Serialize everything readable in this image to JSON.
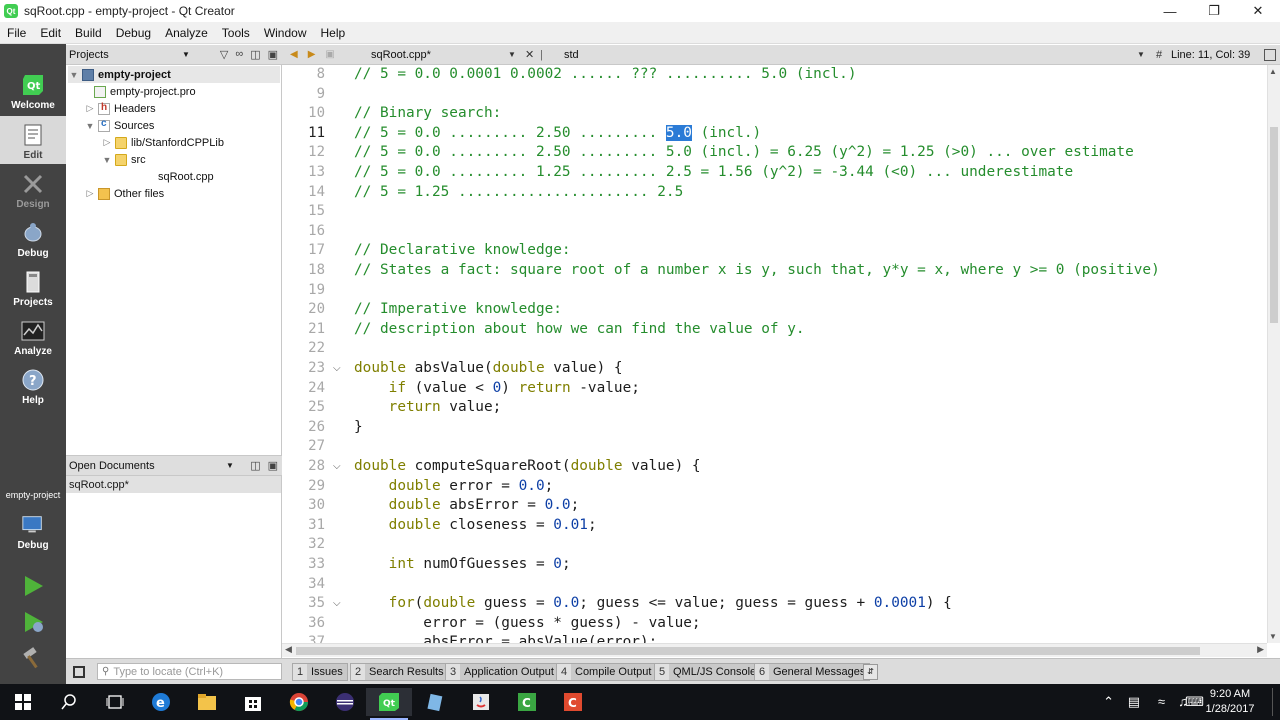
{
  "window": {
    "title": "sqRoot.cpp - empty-project - Qt Creator",
    "minimize": "—",
    "maximize": "❐",
    "close": "✕"
  },
  "menu": [
    "File",
    "Edit",
    "Build",
    "Debug",
    "Analyze",
    "Tools",
    "Window",
    "Help"
  ],
  "modes": {
    "welcome": "Welcome",
    "edit": "Edit",
    "design": "Design",
    "debug": "Debug",
    "projects": "Projects",
    "analyze": "Analyze",
    "help": "Help",
    "target_project": "empty-project",
    "target_mode": "Debug"
  },
  "projects_pane": {
    "header": "Projects",
    "tree": {
      "root": "empty-project",
      "pro_file": "empty-project.pro",
      "headers": "Headers",
      "sources": "Sources",
      "lib": "lib/StanfordCPPLib",
      "src": "src",
      "file": "sqRoot.cpp",
      "other": "Other files"
    }
  },
  "open_documents": {
    "header": "Open Documents",
    "items": [
      "sqRoot.cpp*"
    ]
  },
  "editor_toolbar": {
    "file": "sqRoot.cpp*",
    "symbol": "std",
    "hash": "#",
    "line_info": "Line: 11, Col: 39"
  },
  "editor": {
    "current_line": 11,
    "lines": [
      {
        "n": 8,
        "seg": [
          {
            "t": "// 5 = 0.0 0.0001 0.0002 ...... ??? .......... 5.0 (incl.)",
            "c": "comment"
          }
        ]
      },
      {
        "n": 9,
        "seg": []
      },
      {
        "n": 10,
        "seg": [
          {
            "t": "// Binary search:",
            "c": "comment"
          }
        ]
      },
      {
        "n": 11,
        "seg": [
          {
            "t": "// 5 = 0.0 ......... 2.50 ......... ",
            "c": "comment"
          },
          {
            "t": "5.0",
            "c": "hl"
          },
          {
            "t": " (incl.)",
            "c": "comment"
          }
        ]
      },
      {
        "n": 12,
        "seg": [
          {
            "t": "// 5 = 0.0 ......... 2.50 ......... 5.0 (incl.) = 6.25 (y^2) = 1.25 (>0) ... over estimate",
            "c": "comment"
          }
        ]
      },
      {
        "n": 13,
        "seg": [
          {
            "t": "// 5 = 0.0 ......... 1.25 ......... 2.5 = 1.56 (y^2) = -3.44 (<0) ... underestimate",
            "c": "comment"
          }
        ]
      },
      {
        "n": 14,
        "seg": [
          {
            "t": "// 5 = 1.25 ...................... 2.5",
            "c": "comment"
          }
        ]
      },
      {
        "n": 15,
        "seg": []
      },
      {
        "n": 16,
        "seg": []
      },
      {
        "n": 17,
        "seg": [
          {
            "t": "// Declarative knowledge:",
            "c": "comment"
          }
        ]
      },
      {
        "n": 18,
        "seg": [
          {
            "t": "// States a fact: square root of a number x is y, such that, y*y = x, where y >= 0 (positive)",
            "c": "comment"
          }
        ]
      },
      {
        "n": 19,
        "seg": []
      },
      {
        "n": 20,
        "seg": [
          {
            "t": "// Imperative knowledge:",
            "c": "comment"
          }
        ]
      },
      {
        "n": 21,
        "seg": [
          {
            "t": "// description about how we can find the value of y.",
            "c": "comment"
          }
        ]
      },
      {
        "n": 22,
        "seg": []
      },
      {
        "n": 23,
        "fold": true,
        "seg": [
          {
            "t": "double",
            "c": "kw"
          },
          {
            "t": " absValue(",
            "c": "plain"
          },
          {
            "t": "double",
            "c": "kw"
          },
          {
            "t": " value) {",
            "c": "plain"
          }
        ]
      },
      {
        "n": 24,
        "seg": [
          {
            "t": "    ",
            "c": "plain"
          },
          {
            "t": "if",
            "c": "kw"
          },
          {
            "t": " (value < ",
            "c": "plain"
          },
          {
            "t": "0",
            "c": "num"
          },
          {
            "t": ") ",
            "c": "plain"
          },
          {
            "t": "return",
            "c": "kw"
          },
          {
            "t": " -value;",
            "c": "plain"
          }
        ]
      },
      {
        "n": 25,
        "seg": [
          {
            "t": "    ",
            "c": "plain"
          },
          {
            "t": "return",
            "c": "kw"
          },
          {
            "t": " value;",
            "c": "plain"
          }
        ]
      },
      {
        "n": 26,
        "seg": [
          {
            "t": "}",
            "c": "plain"
          }
        ]
      },
      {
        "n": 27,
        "seg": []
      },
      {
        "n": 28,
        "fold": true,
        "seg": [
          {
            "t": "double",
            "c": "kw"
          },
          {
            "t": " computeSquareRoot(",
            "c": "plain"
          },
          {
            "t": "double",
            "c": "kw"
          },
          {
            "t": " value) {",
            "c": "plain"
          }
        ]
      },
      {
        "n": 29,
        "seg": [
          {
            "t": "    ",
            "c": "plain"
          },
          {
            "t": "double",
            "c": "kw"
          },
          {
            "t": " error = ",
            "c": "plain"
          },
          {
            "t": "0.0",
            "c": "num"
          },
          {
            "t": ";",
            "c": "plain"
          }
        ]
      },
      {
        "n": 30,
        "seg": [
          {
            "t": "    ",
            "c": "plain"
          },
          {
            "t": "double",
            "c": "kw"
          },
          {
            "t": " absError = ",
            "c": "plain"
          },
          {
            "t": "0.0",
            "c": "num"
          },
          {
            "t": ";",
            "c": "plain"
          }
        ]
      },
      {
        "n": 31,
        "seg": [
          {
            "t": "    ",
            "c": "plain"
          },
          {
            "t": "double",
            "c": "kw"
          },
          {
            "t": " closeness = ",
            "c": "plain"
          },
          {
            "t": "0.01",
            "c": "num"
          },
          {
            "t": ";",
            "c": "plain"
          }
        ]
      },
      {
        "n": 32,
        "seg": []
      },
      {
        "n": 33,
        "seg": [
          {
            "t": "    ",
            "c": "plain"
          },
          {
            "t": "int",
            "c": "kw"
          },
          {
            "t": " numOfGuesses = ",
            "c": "plain"
          },
          {
            "t": "0",
            "c": "num"
          },
          {
            "t": ";",
            "c": "plain"
          }
        ]
      },
      {
        "n": 34,
        "seg": []
      },
      {
        "n": 35,
        "fold": true,
        "seg": [
          {
            "t": "    ",
            "c": "plain"
          },
          {
            "t": "for",
            "c": "kw"
          },
          {
            "t": "(",
            "c": "plain"
          },
          {
            "t": "double",
            "c": "kw"
          },
          {
            "t": " guess = ",
            "c": "plain"
          },
          {
            "t": "0.0",
            "c": "num"
          },
          {
            "t": "; guess <= value; guess = guess + ",
            "c": "plain"
          },
          {
            "t": "0.0001",
            "c": "num"
          },
          {
            "t": ") {",
            "c": "plain"
          }
        ]
      },
      {
        "n": 36,
        "seg": [
          {
            "t": "        error = (guess * guess) - value;",
            "c": "plain"
          }
        ]
      },
      {
        "n": 37,
        "seg": [
          {
            "t": "        absError = absValue(error);",
            "c": "plain"
          }
        ]
      }
    ]
  },
  "locator": {
    "placeholder": "Type to locate (Ctrl+K)"
  },
  "output_tabs": [
    {
      "num": "1",
      "label": "Issues"
    },
    {
      "num": "2",
      "label": "Search Results"
    },
    {
      "num": "3",
      "label": "Application Output"
    },
    {
      "num": "4",
      "label": "Compile Output"
    },
    {
      "num": "5",
      "label": "QML/JS Console"
    },
    {
      "num": "6",
      "label": "General Messages"
    }
  ],
  "taskbar": {
    "time": "9:20 AM",
    "date": "1/28/2017",
    "icons": [
      "windows-start",
      "search",
      "task-view",
      "edge",
      "file-explorer",
      "store",
      "chrome",
      "eclipse",
      "qt-creator",
      "notepad",
      "java",
      "camtasia-recorder",
      "camtasia"
    ]
  }
}
